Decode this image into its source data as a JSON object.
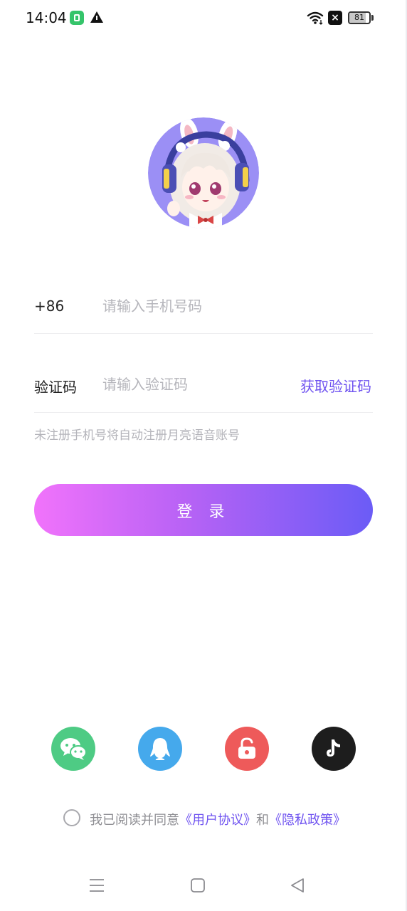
{
  "status_bar": {
    "time": "14:04",
    "battery_level": "81",
    "icons": [
      "app-notification-icon",
      "warning-icon",
      "wifi-icon",
      "no-signal-icon",
      "battery-icon"
    ]
  },
  "form": {
    "country_code": "+86",
    "phone_placeholder": "请输入手机号码",
    "code_label": "验证码",
    "code_placeholder": "请输入验证码",
    "get_code_label": "获取验证码",
    "hint": "未注册手机号将自动注册月亮语音账号",
    "login_label": "登 录"
  },
  "social_login": [
    {
      "name": "wechat",
      "icon": "wechat-icon",
      "color": "#4ecb84"
    },
    {
      "name": "qq",
      "icon": "qq-icon",
      "color": "#45a9ec"
    },
    {
      "name": "password",
      "icon": "unlock-icon",
      "color": "#ee5a5a"
    },
    {
      "name": "tiktok",
      "icon": "tiktok-icon",
      "color": "#1d1d1d"
    }
  ],
  "agreement": {
    "prefix": "我已阅读并同意",
    "user_agreement": "《用户协议》",
    "and": "和",
    "privacy_policy": "《隐私政策》"
  },
  "colors": {
    "accent": "#6f53f0",
    "gradient_start": "#f173fb",
    "gradient_end": "#6b5cf6",
    "placeholder": "#b5b5bb"
  },
  "nav_bar": [
    "menu-icon",
    "home-icon",
    "back-icon"
  ]
}
